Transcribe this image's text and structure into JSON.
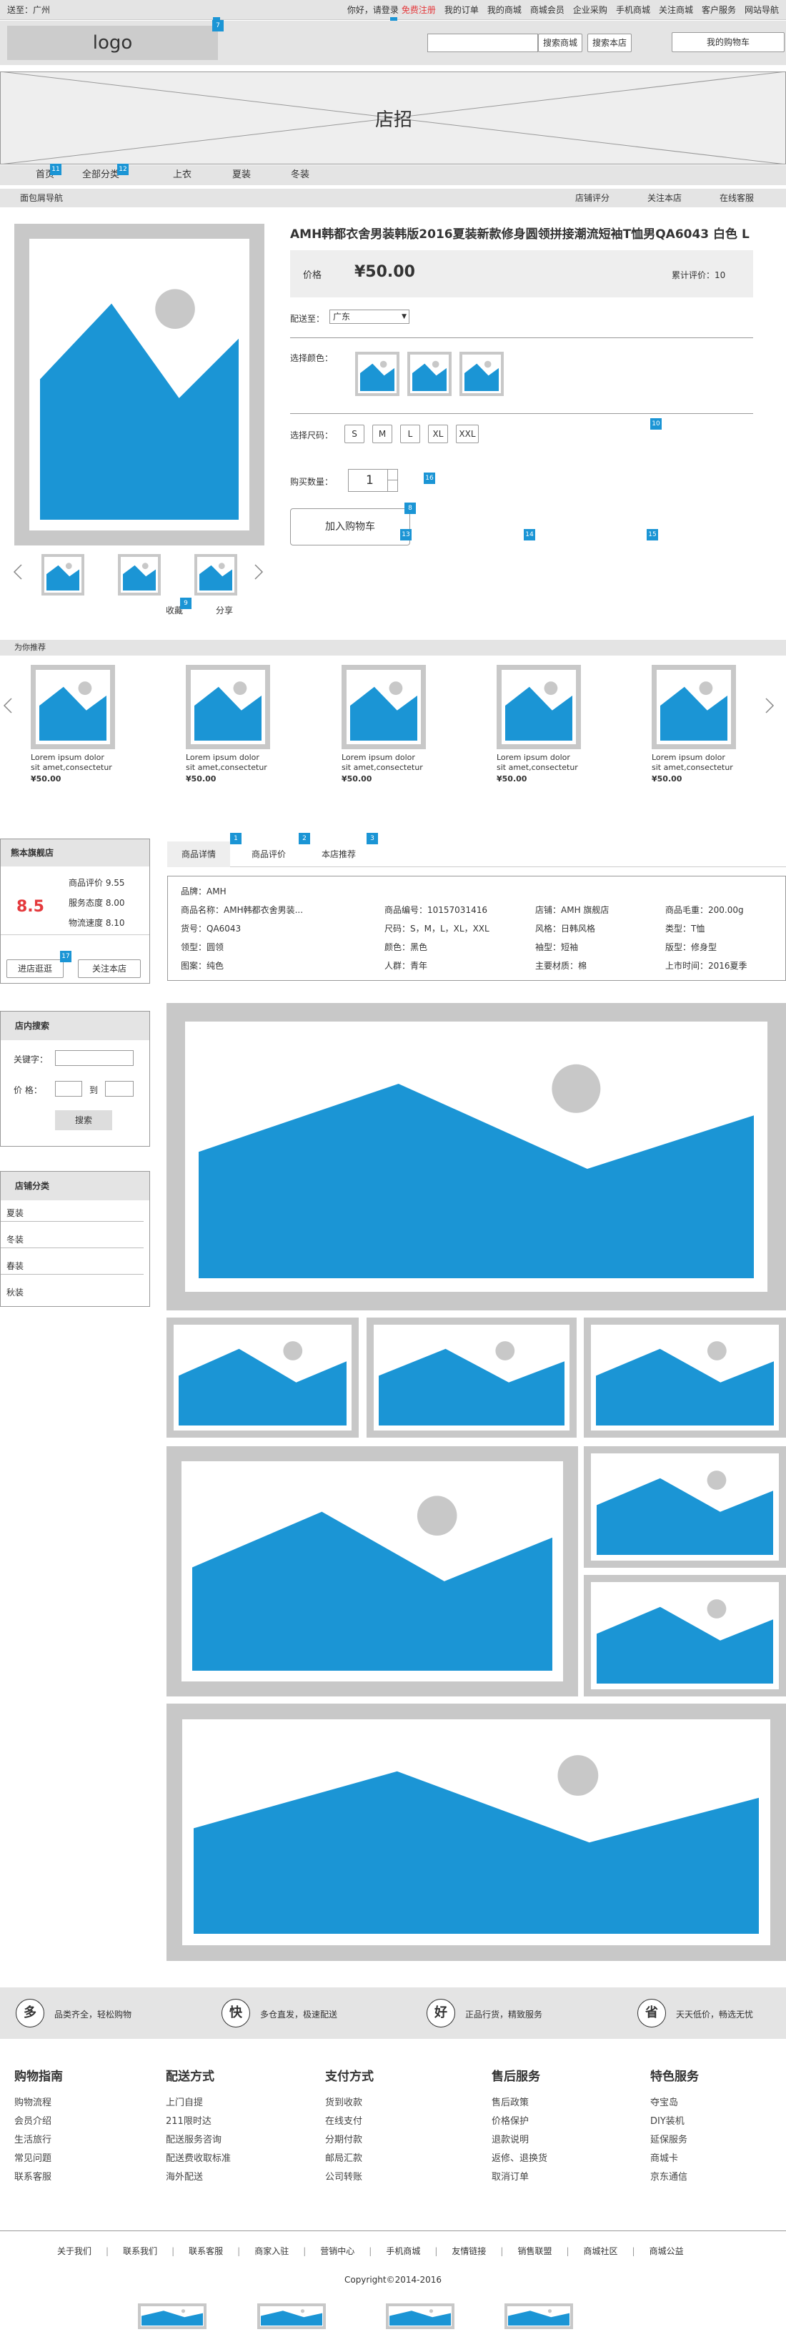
{
  "topbar": {
    "location": "送至：广州",
    "greeting": "你好，请登录",
    "register": "免费注册",
    "nav": [
      "我的订单",
      "我的商城",
      "商城会员",
      "企业采购",
      "手机商城",
      "关注商城",
      "客户服务",
      "网站导航"
    ]
  },
  "header": {
    "logo": "logo",
    "search_mall": "搜索商城",
    "search_store": "搜索本店",
    "cart": "我的购物车"
  },
  "banner": {
    "label": "店招"
  },
  "mainnav": {
    "items": [
      "首页",
      "全部分类",
      "上衣",
      "夏装",
      "冬装"
    ]
  },
  "breadcrumb": {
    "label": "面包屑导航",
    "right": [
      "店铺评分",
      "关注本店",
      "在线客服"
    ]
  },
  "product": {
    "title": "AMH韩都衣舍男装韩版2016夏装新款修身圆领拼接潮流短袖T恤男QA6043 白色 L",
    "price_label": "价格",
    "price": "¥50.00",
    "review": "累计评价：10",
    "ship_label": "配送至：",
    "ship_value": "广东",
    "color_label": "选择颜色：",
    "size_label": "选择尺码：",
    "sizes": [
      "S",
      "M",
      "L",
      "XL",
      "XXL"
    ],
    "qty_label": "购买数量：",
    "qty": "1",
    "cart_btn": "加入购物车",
    "collect": "收藏",
    "share": "分享"
  },
  "recommend": {
    "title": "为你推荐",
    "items": [
      {
        "desc1": "Lorem ipsum dolor",
        "desc2": "sit amet,consectetur",
        "price": "¥50.00"
      },
      {
        "desc1": "Lorem ipsum dolor",
        "desc2": "sit amet,consectetur",
        "price": "¥50.00"
      },
      {
        "desc1": "Lorem ipsum dolor",
        "desc2": "sit amet,consectetur",
        "price": "¥50.00"
      },
      {
        "desc1": "Lorem ipsum dolor",
        "desc2": "sit amet,consectetur",
        "price": "¥50.00"
      },
      {
        "desc1": "Lorem ipsum dolor",
        "desc2": "sit amet,consectetur",
        "price": "¥50.00"
      }
    ]
  },
  "shop": {
    "name": "熊本旗舰店",
    "score": "8.5",
    "ratings": [
      "商品评价  9.55",
      "服务态度  8.00",
      "物流速度  8.10"
    ],
    "enter": "进店逛逛",
    "follow": "关注本店"
  },
  "shopsearch": {
    "title": "店内搜索",
    "kw": "关键字：",
    "price": "价  格：",
    "to": "到",
    "btn": "搜索"
  },
  "shopcat": {
    "title": "店铺分类",
    "items": [
      "夏装",
      "冬装",
      "春装",
      "秋装"
    ]
  },
  "tabs": [
    "商品详情",
    "商品评价",
    "本店推荐"
  ],
  "attrs": [
    [
      "品牌：AMH"
    ],
    [
      "商品名称：AMH韩都衣舍男装...",
      "商品编号：10157031416",
      "店铺：AMH 旗舰店",
      "商品毛重：200.00g"
    ],
    [
      "货号：QA6043",
      "尺码：S，M，L，XL，XXL",
      "风格：日韩风格",
      "类型：T恤"
    ],
    [
      "领型：圆领",
      "颜色：黑色",
      "袖型：短袖",
      "版型：修身型"
    ],
    [
      "图案：纯色",
      "人群：青年",
      "主要材质：棉",
      "上市时间：2016夏季"
    ]
  ],
  "service": [
    {
      "icon": "多",
      "text": "品类齐全，轻松购物"
    },
    {
      "icon": "快",
      "text": "多仓直发，极速配送"
    },
    {
      "icon": "好",
      "text": "正品行货，精致服务"
    },
    {
      "icon": "省",
      "text": "天天低价，畅选无忧"
    }
  ],
  "footer": [
    {
      "title": "购物指南",
      "items": [
        "购物流程",
        "会员介绍",
        "生活旅行",
        "常见问题",
        "联系客服"
      ]
    },
    {
      "title": "配送方式",
      "items": [
        "上门自提",
        "211限时达",
        "配送服务咨询",
        "配送费收取标准",
        "海外配送"
      ]
    },
    {
      "title": "支付方式",
      "items": [
        "货到收款",
        "在线支付",
        "分期付款",
        "邮局汇款",
        "公司转账"
      ]
    },
    {
      "title": "售后服务",
      "items": [
        "售后政策",
        "价格保护",
        "退款说明",
        "返修、退换货",
        "取消订单"
      ]
    },
    {
      "title": "特色服务",
      "items": [
        "夺宝岛",
        "DIY装机",
        "延保服务",
        "商城卡",
        "京东通信"
      ]
    }
  ],
  "bottomlinks": [
    "关于我们",
    "联系我们",
    "联系客服",
    "商家入驻",
    "营销中心",
    "手机商城",
    "友情链接",
    "销售联盟",
    "商城社区",
    "商城公益"
  ],
  "copyright": "Copyright©2014-2016",
  "badges": {
    "b7": "7",
    "b11": "11",
    "b12": "12",
    "b8": "8",
    "b9": "9",
    "b10": "10",
    "b13": "13",
    "b14": "14",
    "b15": "15",
    "b16": "16",
    "b1": "1",
    "b2": "2",
    "b3": "3",
    "b17": "17",
    "b5": "5"
  }
}
